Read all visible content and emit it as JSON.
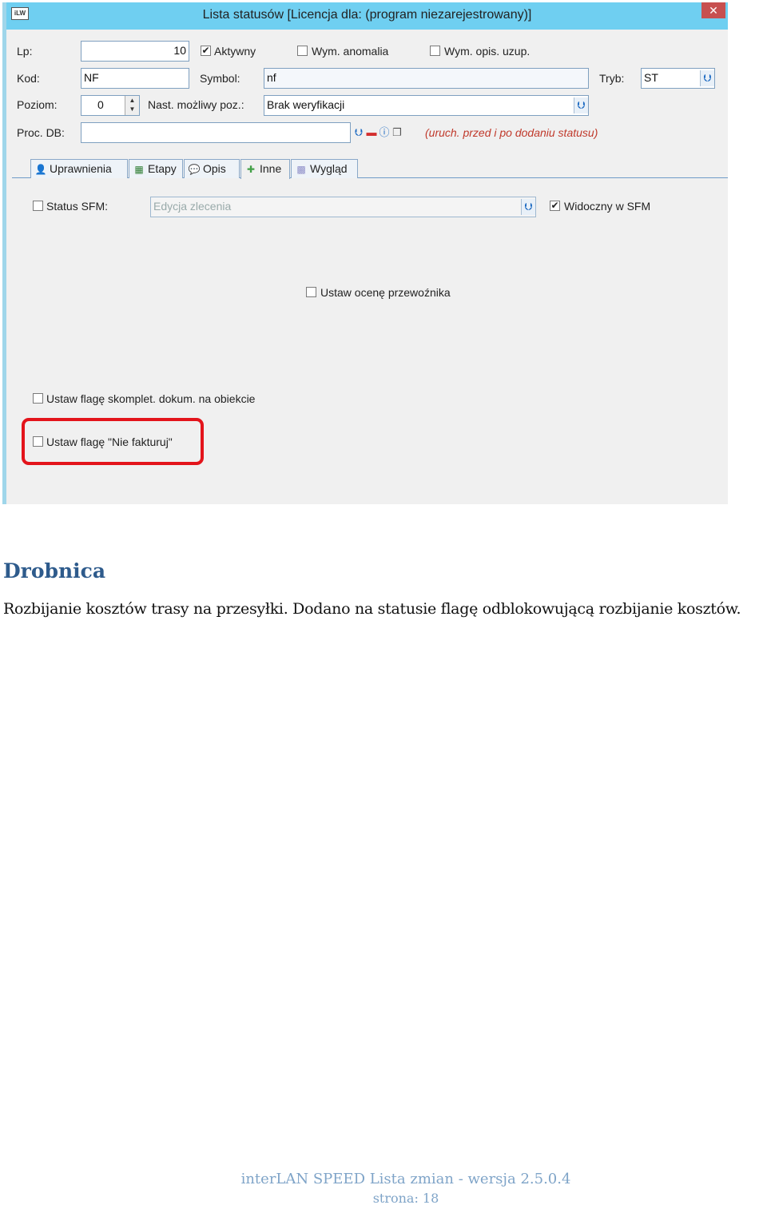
{
  "window": {
    "title": "Lista statusów  [Licencja dla: (program niezarejestrowany)]",
    "close_label": "✕"
  },
  "form": {
    "lp_label": "Lp:",
    "lp_value": "10",
    "aktywny_label": "Aktywny",
    "aktywny_checked": "✔",
    "wym_anomalia_label": "Wym. anomalia",
    "wym_opis_label": "Wym. opis. uzup.",
    "kod_label": "Kod:",
    "kod_value": "NF",
    "symbol_label": "Symbol:",
    "symbol_value": "nf",
    "tryb_label": "Tryb:",
    "tryb_value": "ST",
    "poziom_label": "Poziom:",
    "poziom_value": "0",
    "nast_label": "Nast. możliwy poz.:",
    "nast_value": "Brak weryfikacji",
    "proc_label": "Proc. DB:",
    "proc_value": "",
    "proc_hint": "(uruch. przed i po dodaniu statusu)"
  },
  "tabs": [
    {
      "label": "Uprawnienia"
    },
    {
      "label": "Etapy"
    },
    {
      "label": "Opis"
    },
    {
      "label": "Inne"
    },
    {
      "label": "Wygląd"
    }
  ],
  "inne": {
    "status_sfm_label": "Status SFM:",
    "status_sfm_value": "Edycja zlecenia",
    "widoczny_label": "Widoczny w SFM",
    "widoczny_checked": "✔",
    "ocena_label": "Ustaw ocenę przewoźnika",
    "skomplet_label": "Ustaw flagę skomplet. dokum. na obiekcie",
    "niefakturuj_label": "Ustaw flagę \"Nie fakturuj\""
  },
  "doc": {
    "heading": "Drobnica",
    "paragraph": "Rozbijanie kosztów trasy na przesyłki. Dodano na statusie flagę odblokowującą rozbijanie kosztów.",
    "footer_title": "interLAN SPEED Lista zmian - wersja 2.5.0.4",
    "footer_page": "strona: 18"
  },
  "colors": {
    "titlebar": "#6fcff1",
    "highlight": "#e3141b",
    "heading": "#2e5b8c",
    "hint": "#c0392b"
  }
}
